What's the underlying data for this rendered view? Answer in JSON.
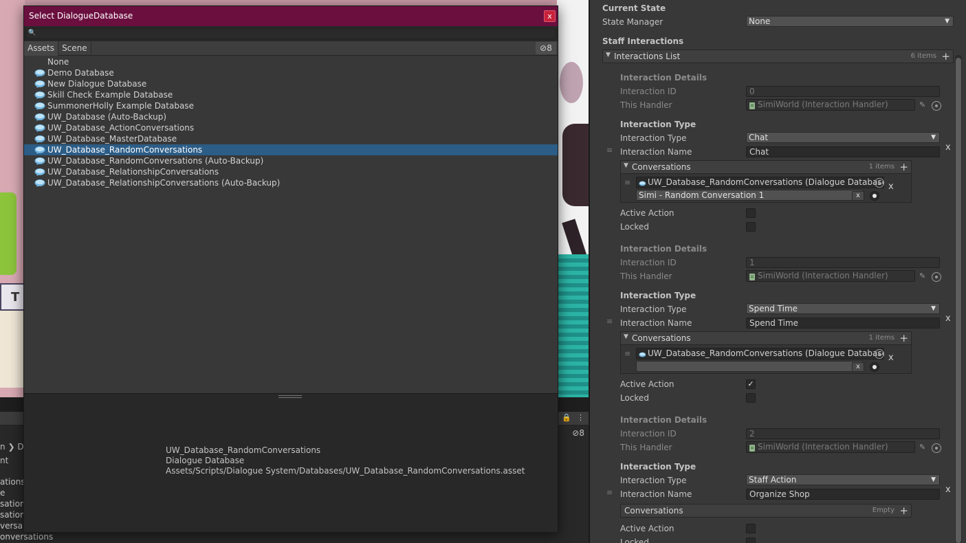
{
  "picker": {
    "title": "Select DialogueDatabase",
    "close_label": "x",
    "search_placeholder": "",
    "tabs": [
      "Assets",
      "Scene"
    ],
    "visibility_count": "8",
    "items": [
      "None",
      "Demo Database",
      "New Dialogue Database",
      "Skill Check Example Database",
      "SummonerHolly Example Database",
      "UW_Database (Auto-Backup)",
      "UW_Database_ActionConversations",
      "UW_Database_MasterDatabase",
      "UW_Database_RandomConversations",
      "UW_Database_RandomConversations (Auto-Backup)",
      "UW_Database_RelationshipConversations",
      "UW_Database_RelationshipConversations (Auto-Backup)"
    ],
    "selected_index": 8,
    "preview": {
      "name": "UW_Database_RandomConversations",
      "type": "Dialogue Database",
      "path": "Assets/Scripts/Dialogue System/Databases/UW_Database_RandomConversations.asset"
    }
  },
  "project_panel": {
    "visibility_count": "8",
    "crumb": "n",
    "crumb_next": "Da",
    "crumb2": "nt",
    "list": [
      "ations",
      "e",
      "sations",
      "sation",
      "versa",
      "onversations"
    ]
  },
  "inspector": {
    "current_state_header": "Current State",
    "state_manager_label": "State Manager",
    "state_manager_value": "None",
    "staff_interactions_header": "Staff Interactions",
    "interactions_list_label": "Interactions List",
    "interactions_list_count": "6 items",
    "interactions": [
      {
        "details_header": "Interaction Details",
        "id_label": "Interaction ID",
        "id_value": "0",
        "handler_label": "This Handler",
        "handler_value": "SimiWorld (Interaction Handler)",
        "type_header": "Interaction Type",
        "type_label": "Interaction Type",
        "type_value": "Chat",
        "name_label": "Interaction Name",
        "name_value": "Chat",
        "conversations_label": "Conversations",
        "conversations_count": "1 items",
        "conv_db": "UW_Database_RandomConversations (Dialogue Database)",
        "conv_title": "Simi - Random Conversation 1",
        "active_label": "Active Action",
        "active": false,
        "locked_label": "Locked",
        "locked": false
      },
      {
        "details_header": "Interaction Details",
        "id_label": "Interaction ID",
        "id_value": "1",
        "handler_label": "This Handler",
        "handler_value": "SimiWorld (Interaction Handler)",
        "type_header": "Interaction Type",
        "type_label": "Interaction Type",
        "type_value": "Spend Time",
        "name_label": "Interaction Name",
        "name_value": "Spend Time",
        "conversations_label": "Conversations",
        "conversations_count": "1 items",
        "conv_db": "UW_Database_RandomConversations (Dialogue Database)",
        "conv_title": "",
        "active_label": "Active Action",
        "active": true,
        "locked_label": "Locked",
        "locked": false
      },
      {
        "details_header": "Interaction Details",
        "id_label": "Interaction ID",
        "id_value": "2",
        "handler_label": "This Handler",
        "handler_value": "SimiWorld (Interaction Handler)",
        "type_header": "Interaction Type",
        "type_label": "Interaction Type",
        "type_value": "Staff Action",
        "name_label": "Interaction Name",
        "name_value": "Organize Shop",
        "conversations_label": "Conversations",
        "conversations_count": "Empty",
        "active_label": "Active Action",
        "active": false,
        "locked_label": "Locked",
        "locked": false
      }
    ],
    "remove_label": "x",
    "clear_label": "x",
    "check_mark": "✓",
    "plus_label": "+"
  },
  "colors": {
    "title_bar": "#6b0f3f",
    "selection": "#2c5d87",
    "close_button": "#c8213a"
  }
}
